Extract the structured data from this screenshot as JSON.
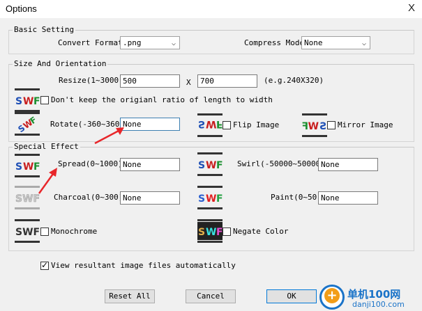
{
  "window": {
    "title": "Options",
    "close_label": "X"
  },
  "basic": {
    "label": "Basic Setting",
    "convert_format_label": "Convert Format",
    "convert_format_value": ".png",
    "compress_mode_label": "Compress Mode",
    "compress_mode_value": "None"
  },
  "size": {
    "label": "Size And Orientation",
    "resize_label": "Resize(1~3000)",
    "width_value": "500",
    "x_label": "X",
    "height_value": "700",
    "example": "(e.g.240X320)",
    "keep_ratio_label": "Don't keep the origianl ratio of length to width",
    "rotate_label": "Rotate(-360~360)",
    "rotate_value": "None",
    "flip_label": "Flip Image",
    "mirror_label": "Mirror Image"
  },
  "effect": {
    "label": "Special Effect",
    "spread_label": "Spread(0~1000)",
    "spread_value": "None",
    "swirl_label": "Swirl(-50000~50000)",
    "swirl_value": "None",
    "charcoal_label": "Charcoal(0~300)",
    "charcoal_value": "None",
    "paint_label": "Paint(0~50)",
    "paint_value": "None",
    "monochrome_label": "Monochrome",
    "negate_label": "Negate Color"
  },
  "view_auto_label": "View resultant image files automatically",
  "view_auto_checked": true,
  "buttons": {
    "reset": "Reset All",
    "cancel": "Cancel",
    "ok": "OK"
  },
  "watermark": {
    "site_cn": "单机100网",
    "site_url": "danji100.com"
  },
  "icons": {
    "swf_text": "SWF",
    "flip_text": "SWF",
    "mirror_text": "SWF"
  },
  "colors": {
    "accent": "#0078d7",
    "arrow": "#e8262a",
    "watermark_blue": "#1a73c8"
  }
}
